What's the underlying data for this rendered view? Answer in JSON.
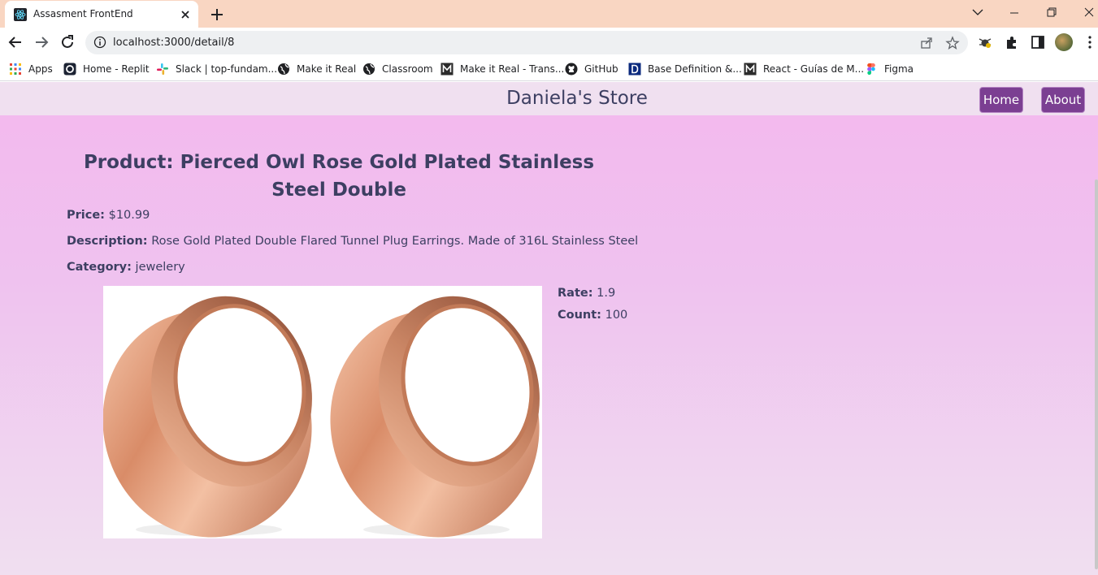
{
  "browser": {
    "tab_title": "Assasment FrontEnd",
    "url": "localhost:3000/detail/8",
    "bookmarks": [
      {
        "label": "Apps",
        "icon": "apps-grid-icon"
      },
      {
        "label": "Home - Replit",
        "icon": "replit-icon"
      },
      {
        "label": "Slack | top-fundam...",
        "icon": "slack-icon"
      },
      {
        "label": "Make it Real",
        "icon": "globe-icon"
      },
      {
        "label": "Classroom",
        "icon": "globe-icon"
      },
      {
        "label": "Make it Real - Trans...",
        "icon": "makeitreal-icon"
      },
      {
        "label": "GitHub",
        "icon": "github-icon"
      },
      {
        "label": "Base Definition &...",
        "icon": "d-icon"
      },
      {
        "label": "React - Guías de M...",
        "icon": "makeitreal-icon"
      },
      {
        "label": "Figma",
        "icon": "figma-icon"
      }
    ]
  },
  "site": {
    "store_name": "Daniela's Store",
    "nav": {
      "home": "Home",
      "about": "About"
    }
  },
  "product": {
    "title": "Product: Pierced Owl Rose Gold Plated Stainless Steel Double",
    "price_label": "Price:",
    "price": "$10.99",
    "description_label": "Description:",
    "description": "Rose Gold Plated Double Flared Tunnel Plug Earrings. Made of 316L Stainless Steel",
    "category_label": "Category:",
    "category": "jewelery",
    "rate_label": "Rate:",
    "rate": "1.9",
    "count_label": "Count:",
    "count": "100"
  },
  "colors": {
    "tabstrip": "#f9d6c2",
    "accent_button": "#7b3f92",
    "heading_text": "#3d3f62",
    "page_gradient_top": "#f4b8ee",
    "page_gradient_bottom": "#f0dff0"
  }
}
